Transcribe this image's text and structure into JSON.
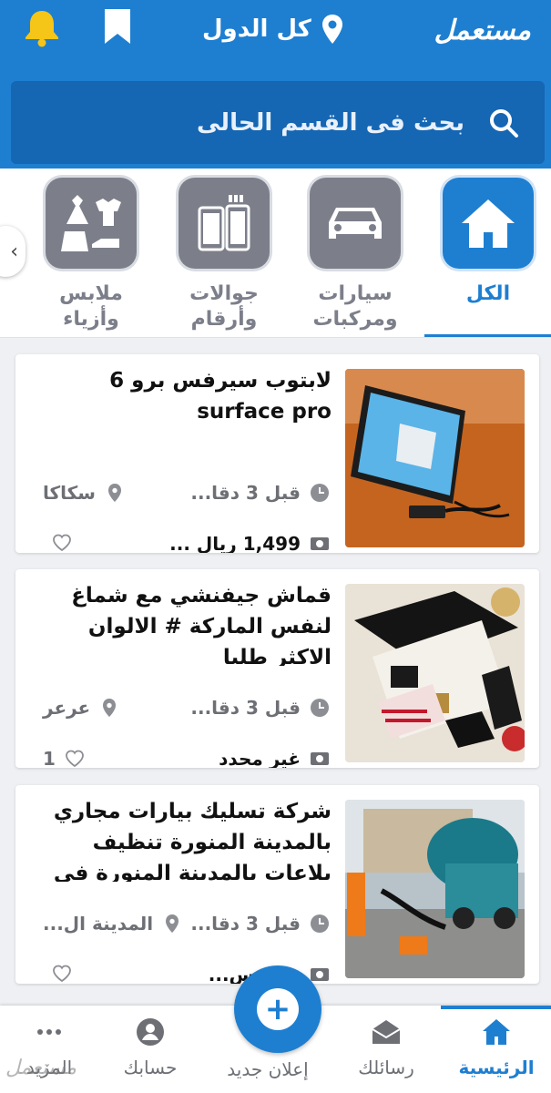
{
  "header": {
    "logo": "مستعمل",
    "country_label": "كل الدول",
    "icons": {
      "notifications": "bell-icon",
      "saved": "bookmark-icon",
      "location": "location-pin-icon"
    },
    "colors": {
      "primary": "#1e7fd1",
      "search_bg": "#1566b3",
      "notification": "#f5c518"
    }
  },
  "search": {
    "placeholder": "بحث فى القسم الحالى"
  },
  "categories": [
    {
      "label": "الكل",
      "icon": "home-icon",
      "active": true
    },
    {
      "label": "سيارات ومركبات",
      "icon": "car-icon",
      "active": false
    },
    {
      "label": "جوالات وأرقام",
      "icon": "phones-icon",
      "active": false
    },
    {
      "label": "ملابس وأزياء",
      "icon": "clothes-icon",
      "active": false
    }
  ],
  "listings": [
    {
      "title": "لابتوب سيرفس برو 6 surface pro",
      "time": "قبل 3 دقا...",
      "location": "سكاكا",
      "price": "1,499 ريال ...",
      "likes": ""
    },
    {
      "title": "قماش جيفنشي مع شماغ لنفس الماركة # الالوان الاكثر طلبا",
      "time": "قبل 3 دقا...",
      "location": "عرعر",
      "price": "غير محدد",
      "likes": "1"
    },
    {
      "title": "شركة تسليك بيارات مجاري بالمدينة المنورة تنظيف بلاعات بالمدينة المنورة في",
      "time": "قبل 3 دقا...",
      "location": "المدينة ال...",
      "price": "ريال س...",
      "likes": ""
    }
  ],
  "bottom_nav": {
    "home": "الرئيسية",
    "messages": "رسائلك",
    "new_ad": "إعلان جديد",
    "account": "حسابك",
    "more": "المزيد"
  },
  "watermark": "مستعمل"
}
